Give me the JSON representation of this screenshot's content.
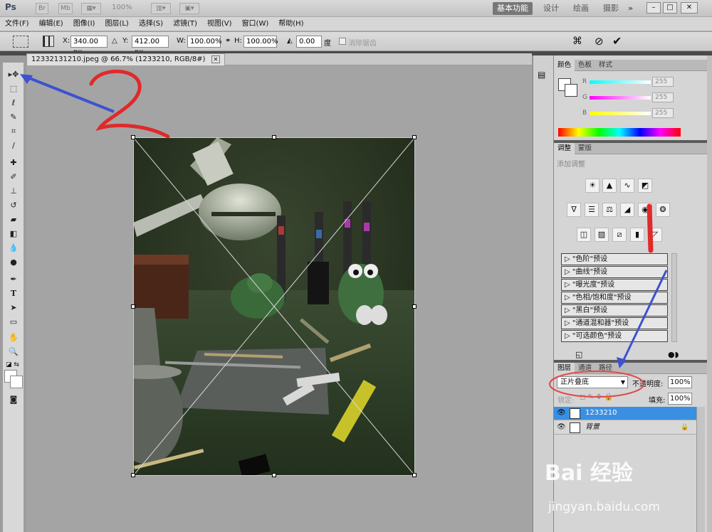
{
  "topbar": {
    "logo": "Ps",
    "btn_br": "Br",
    "btn_mb": "Mb",
    "zoom": "100%",
    "workspaces": [
      "基本功能",
      "设计",
      "绘画",
      "摄影"
    ],
    "more": "»"
  },
  "menus": [
    "文件(F)",
    "编辑(E)",
    "图像(I)",
    "图层(L)",
    "选择(S)",
    "滤镜(T)",
    "视图(V)",
    "窗口(W)",
    "帮助(H)"
  ],
  "options": {
    "x_label": "X:",
    "x_value": "340.00 px",
    "y_label": "Y:",
    "y_value": "412.00 px",
    "w_label": "W:",
    "w_value": "100.00%",
    "h_label": "H:",
    "h_value": "100.00%",
    "angle_value": "0.00",
    "angle_unit": "度",
    "antialias": "消除锯齿"
  },
  "document": {
    "tab_title": "12332131210.jpeg @ 66.7% (1233210, RGB/8#)"
  },
  "color_panel": {
    "tabs": [
      "颜色",
      "色板",
      "样式"
    ],
    "channels": [
      {
        "label": "R",
        "value": "255"
      },
      {
        "label": "G",
        "value": "255"
      },
      {
        "label": "B",
        "value": "255"
      }
    ]
  },
  "adjust_panel": {
    "tabs": [
      "调整",
      "蒙版"
    ],
    "title": "添加调整",
    "presets": [
      "\"色阶\"预设",
      "\"曲线\"预设",
      "\"曝光度\"预设",
      "\"色相/饱和度\"预设",
      "\"黑白\"预设",
      "\"通道混和器\"预设",
      "\"可选颜色\"预设"
    ]
  },
  "layers_panel": {
    "tabs": [
      "图层",
      "通道",
      "路径"
    ],
    "blend_mode": "正片叠底",
    "opacity_label": "不透明度:",
    "opacity_value": "100%",
    "lock_label": "锁定:",
    "fill_label": "填充:",
    "fill_value": "100%",
    "layers": [
      {
        "name": "1233210",
        "selected": true
      },
      {
        "name": "背景",
        "selected": false
      }
    ]
  },
  "annotations": {
    "mark_2": "2",
    "mark_1": "1"
  },
  "watermark": {
    "brand": "Bai 经验",
    "url": "jingyan.baidu.com"
  }
}
